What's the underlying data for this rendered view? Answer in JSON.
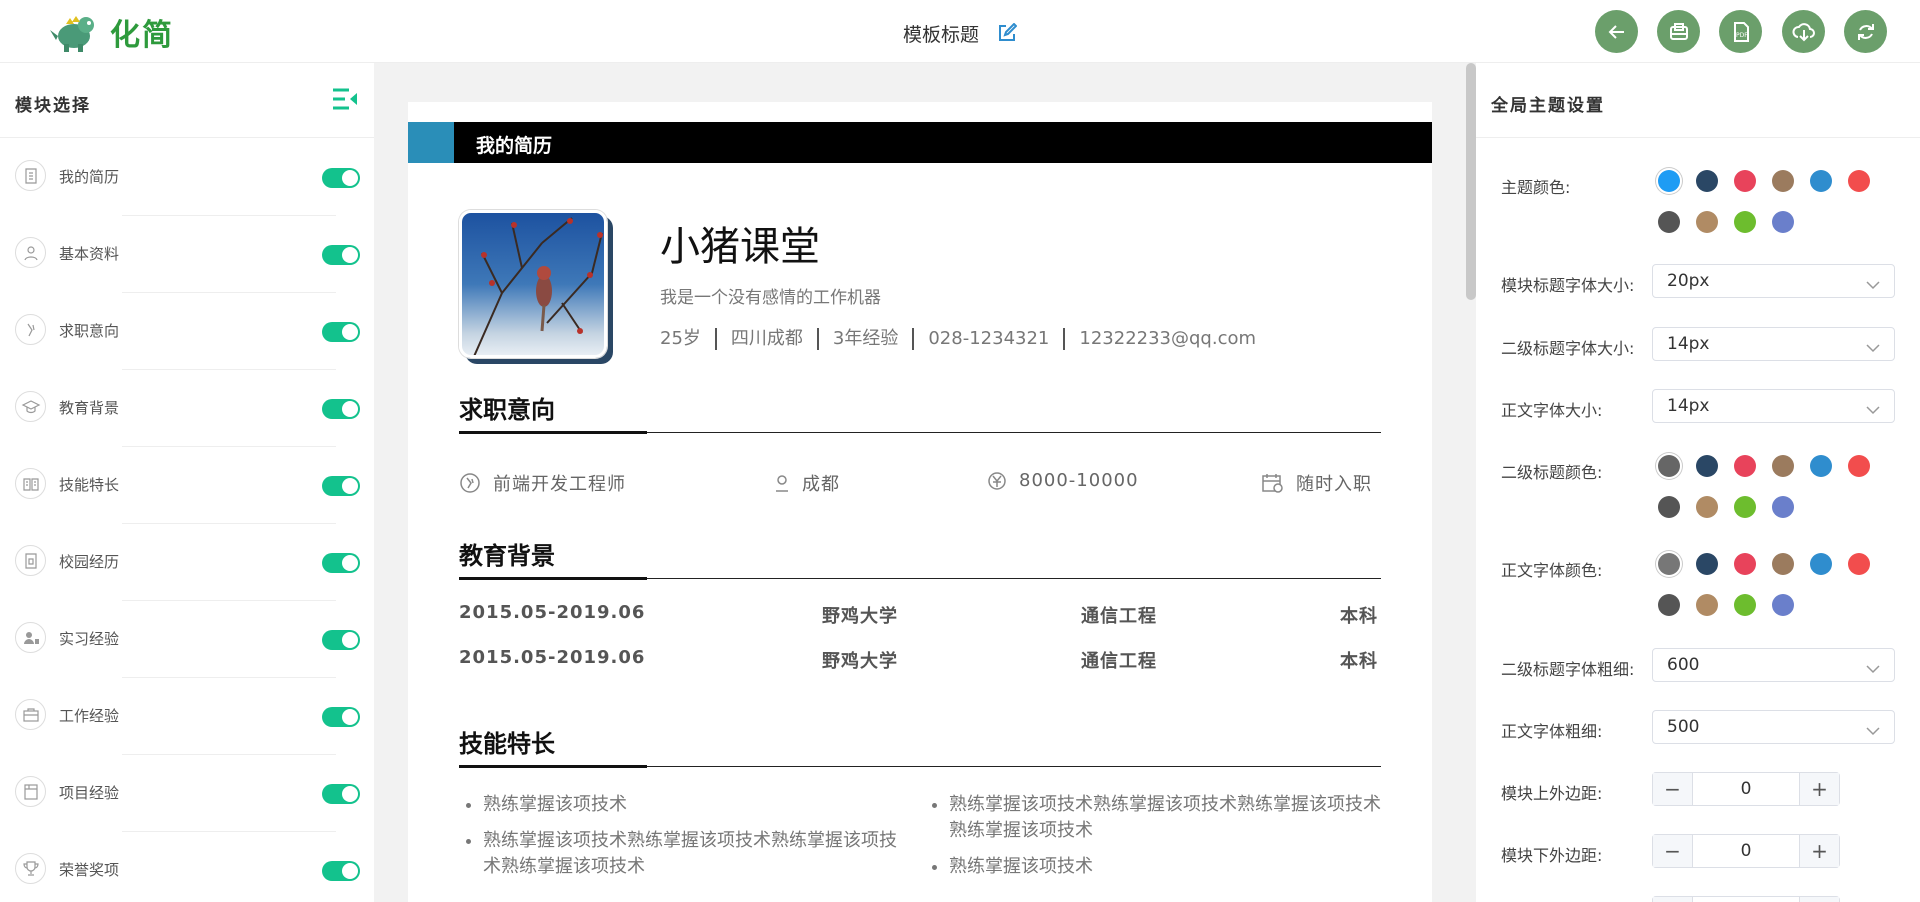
{
  "header": {
    "logo_text": "化简",
    "doc_title": "模板标题",
    "buttons": [
      "back-icon",
      "save-icon",
      "pdf-icon",
      "download-icon",
      "refresh-icon"
    ],
    "button_color": "#6b9f6b"
  },
  "left_panel": {
    "title": "模块选择",
    "toggle_color": "#13c28d",
    "modules": [
      {
        "label": "我的简历",
        "icon": "resume-icon",
        "enabled": true
      },
      {
        "label": "基本资料",
        "icon": "user-icon",
        "enabled": true
      },
      {
        "label": "求职意向",
        "icon": "job-intent-icon",
        "enabled": true
      },
      {
        "label": "教育背景",
        "icon": "graduation-icon",
        "enabled": true
      },
      {
        "label": "技能特长",
        "icon": "book-icon",
        "enabled": true
      },
      {
        "label": "校园经历",
        "icon": "campus-icon",
        "enabled": true
      },
      {
        "label": "实习经验",
        "icon": "intern-icon",
        "enabled": true
      },
      {
        "label": "工作经验",
        "icon": "briefcase-icon",
        "enabled": true
      },
      {
        "label": "项目经验",
        "icon": "project-icon",
        "enabled": true
      },
      {
        "label": "荣誉奖项",
        "icon": "trophy-icon",
        "enabled": true
      }
    ]
  },
  "resume": {
    "banner_title": "我的简历",
    "banner_accent": "#2a8eb8",
    "name": "小猪课堂",
    "motto": "我是一个没有感情的工作机器",
    "infos": [
      "25岁",
      "四川成都",
      "3年经验",
      "028-1234321",
      "12322233@qq.com"
    ],
    "job_section": {
      "title": "求职意向",
      "position": "前端开发工程师",
      "city": "成都",
      "salary": "8000-10000",
      "availability": "随时入职"
    },
    "edu_section": {
      "title": "教育背景",
      "rows": [
        {
          "period": "2015.05-2019.06",
          "school": "野鸡大学",
          "major": "通信工程",
          "degree": "本科"
        },
        {
          "period": "2015.05-2019.06",
          "school": "野鸡大学",
          "major": "通信工程",
          "degree": "本科"
        }
      ]
    },
    "skills_section": {
      "title": "技能特长",
      "left": [
        "熟练掌握该项技术",
        "熟练掌握该项技术熟练掌握该项技术熟练掌握该项技术熟练掌握该项技术"
      ],
      "right": [
        "熟练掌握该项技术熟练掌握该项技术熟练掌握该项技术熟练掌握该项技术",
        "熟练掌握该项技术"
      ]
    }
  },
  "right_panel": {
    "title": "全局主题设置",
    "theme_color_label": "主题颜色:",
    "theme_colors": [
      "#1e9cf4",
      "#2a4765",
      "#e8435b",
      "#9b7b5e",
      "#2f8dce",
      "#f24d4d",
      "#555555",
      "#b08b64",
      "#6dbd2e",
      "#6a7fcb"
    ],
    "module_title_size_label": "模块标题字体大小:",
    "module_title_size": "20px",
    "sub_title_size_label": "二级标题字体大小:",
    "sub_title_size": "14px",
    "body_size_label": "正文字体大小:",
    "body_size": "14px",
    "sub_title_color_label": "二级标题颜色:",
    "sub_title_colors": [
      "#666666",
      "#2a4765",
      "#e8435b",
      "#9b7b5e",
      "#2f8dce",
      "#f24d4d",
      "#555555",
      "#b08b64",
      "#6dbd2e",
      "#6a7fcb"
    ],
    "body_color_label": "正文字体颜色:",
    "body_colors": [
      "#777777",
      "#2a4765",
      "#e8435b",
      "#9b7b5e",
      "#2f8dce",
      "#f24d4d",
      "#555555",
      "#b08b64",
      "#6dbd2e",
      "#6a7fcb"
    ],
    "sub_title_weight_label": "二级标题字体粗细:",
    "sub_title_weight": "600",
    "body_weight_label": "正文字体粗细:",
    "body_weight": "500",
    "margin_top_label": "模块上外边距:",
    "margin_top": "0",
    "margin_bottom_label": "模块下外边距:",
    "margin_bottom": "0"
  }
}
